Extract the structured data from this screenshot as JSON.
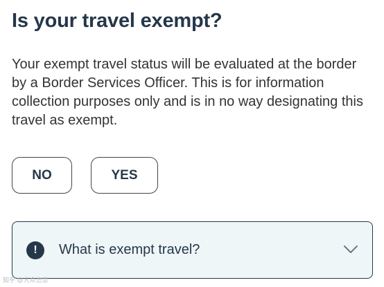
{
  "title": "Is your travel exempt?",
  "description": "Your exempt travel status will be evaluated at the border by a Border Services Officer. This is for information collection purposes only and is in no way designating this travel as exempt.",
  "answers": {
    "no_label": "NO",
    "yes_label": "YES"
  },
  "accordion": {
    "icon": "info-icon",
    "icon_glyph": "!",
    "label": "What is exempt travel?",
    "expand_icon": "chevron-down-icon"
  },
  "watermark": "知乎 @大众信息",
  "colors": {
    "primary_text": "#26374a",
    "body_text": "#333333",
    "accordion_background": "#eef6f8",
    "button_border": "#444444"
  }
}
